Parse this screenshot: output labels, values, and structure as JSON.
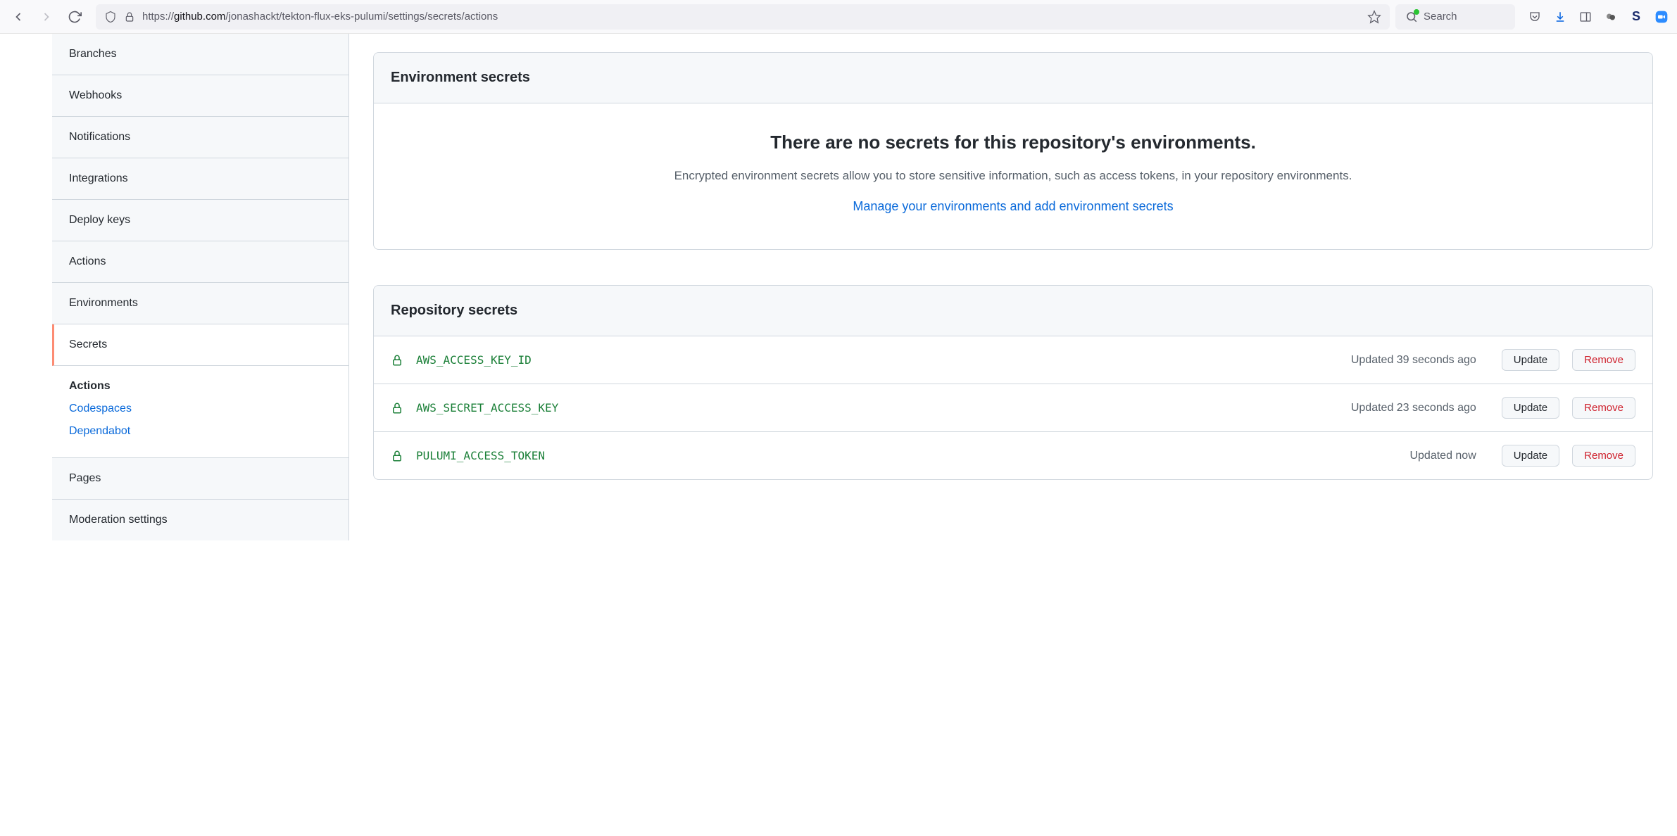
{
  "browser": {
    "url_prefix": "https://",
    "url_domain": "github.com",
    "url_path": "/jonashackt/tekton-flux-eks-pulumi/settings/secrets/actions",
    "search_placeholder": "Search"
  },
  "sidebar": {
    "items": [
      {
        "label": "Branches",
        "active": false
      },
      {
        "label": "Webhooks",
        "active": false
      },
      {
        "label": "Notifications",
        "active": false
      },
      {
        "label": "Integrations",
        "active": false
      },
      {
        "label": "Deploy keys",
        "active": false
      },
      {
        "label": "Actions",
        "active": false
      },
      {
        "label": "Environments",
        "active": false
      },
      {
        "label": "Secrets",
        "active": true
      }
    ],
    "subsection": {
      "title": "Actions",
      "links": [
        {
          "label": "Codespaces"
        },
        {
          "label": "Dependabot"
        }
      ]
    },
    "items_after": [
      {
        "label": "Pages",
        "active": false
      },
      {
        "label": "Moderation settings",
        "active": false
      }
    ]
  },
  "env_secrets": {
    "header": "Environment secrets",
    "title": "There are no secrets for this repository's environments.",
    "description": "Encrypted environment secrets allow you to store sensitive information, such as access tokens, in your repository environments.",
    "link": "Manage your environments and add environment secrets"
  },
  "repo_secrets": {
    "header": "Repository secrets",
    "items": [
      {
        "name": "AWS_ACCESS_KEY_ID",
        "updated": "Updated 39 seconds ago"
      },
      {
        "name": "AWS_SECRET_ACCESS_KEY",
        "updated": "Updated 23 seconds ago"
      },
      {
        "name": "PULUMI_ACCESS_TOKEN",
        "updated": "Updated now"
      }
    ],
    "update_label": "Update",
    "remove_label": "Remove"
  }
}
